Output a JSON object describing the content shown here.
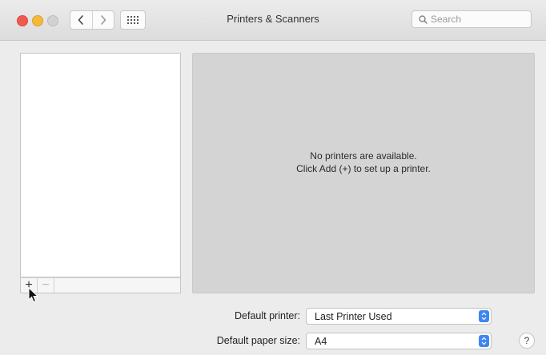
{
  "window": {
    "title": "Printers & Scanners"
  },
  "toolbar": {
    "search_placeholder": "Search",
    "back_icon": "chevron-left-icon",
    "forward_icon": "chevron-right-icon",
    "grid_icon": "grid-icon"
  },
  "printer_list": {
    "add_label": "+",
    "remove_label": "−",
    "items": []
  },
  "detail": {
    "empty_line1": "No printers are available.",
    "empty_line2": "Click Add (+) to set up a printer."
  },
  "settings": {
    "default_printer_label": "Default printer:",
    "default_printer_value": "Last Printer Used",
    "default_paper_label": "Default paper size:",
    "default_paper_value": "A4"
  },
  "help": {
    "label": "?"
  },
  "colors": {
    "close": "#f15b4f",
    "minimize": "#f6b93a",
    "zoom": "#d2d2d2",
    "popup_accent": "#3d86f0"
  }
}
